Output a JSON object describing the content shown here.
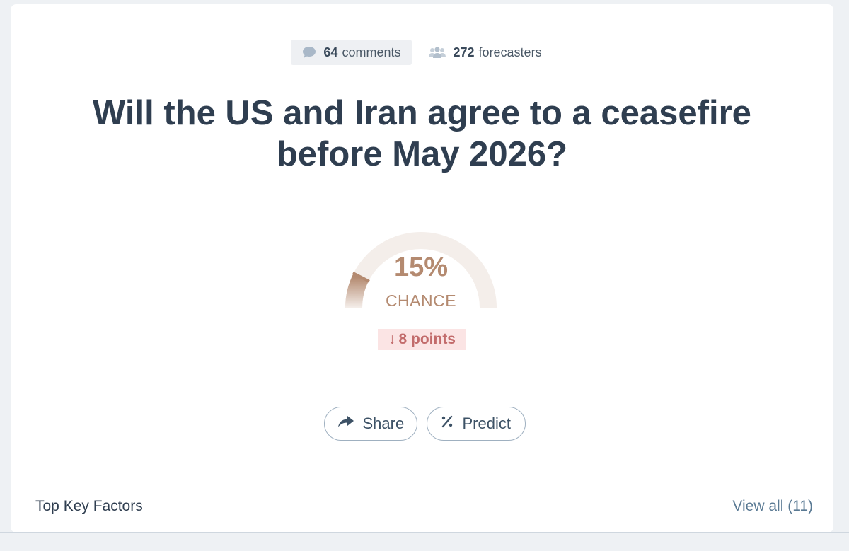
{
  "stats": {
    "comments_count": "64",
    "comments_label": "comments",
    "forecasters_count": "272",
    "forecasters_label": "forecasters"
  },
  "question": {
    "title": "Will the US and Iran agree to a ceasefire before May 2026?"
  },
  "gauge": {
    "percent": "15%",
    "percent_value": 15,
    "label": "CHANCE",
    "color": "#b48a70",
    "track_color": "#f4eeea"
  },
  "change": {
    "arrow": "↓",
    "text": "8 points",
    "color": "#c26b6b"
  },
  "actions": {
    "share_label": "Share",
    "predict_label": "Predict"
  },
  "key_factors": {
    "heading": "Top Key Factors",
    "view_all_label": "View all (11)"
  }
}
